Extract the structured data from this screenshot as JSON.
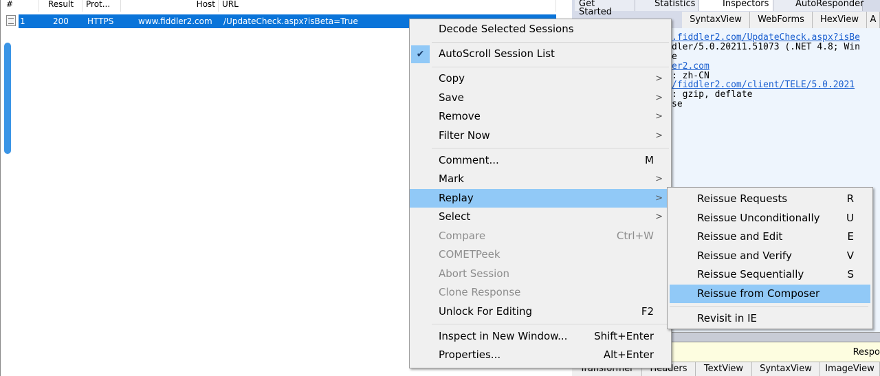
{
  "session_list": {
    "columns": [
      "#",
      "Result",
      "Prot...",
      "Host",
      "URL"
    ],
    "rows": [
      {
        "num": "1",
        "result": "200",
        "protocol": "HTTPS",
        "host": "www.fiddler2.com",
        "url": "/UpdateCheck.aspx?isBeta=True"
      }
    ]
  },
  "right_pane": {
    "tabs": [
      "Get Started",
      "Statistics",
      "Inspectors",
      "AutoResponder"
    ],
    "subtabs": [
      "SyntaxView",
      "WebForms",
      "HexView",
      "A"
    ],
    "request_lines": [
      ".fiddler2.com/UpdateCheck.aspx?isBe",
      "dler/5.0.20211.51073 (.NET 4.8; Win",
      "e",
      "er2.com",
      ": zh-CN",
      "/fiddler2.com/client/TELE/5.0.2021",
      ": gzip, deflate",
      "se"
    ],
    "response_bar": "Respo",
    "bottom_tabs": [
      "Transformer",
      "Headers",
      "TextView",
      "SyntaxView",
      "ImageView"
    ]
  },
  "context_menu": {
    "decode": "Decode Selected Sessions",
    "autoscroll": "AutoScroll Session List",
    "copy": "Copy",
    "save": "Save",
    "remove": "Remove",
    "filter_now": "Filter Now",
    "comment": "Comment...",
    "comment_sc": "M",
    "mark": "Mark",
    "replay": "Replay",
    "select": "Select",
    "compare": "Compare",
    "compare_sc": "Ctrl+W",
    "cometpeek": "COMETPeek",
    "abort": "Abort Session",
    "clone": "Clone Response",
    "unlock": "Unlock For Editing",
    "unlock_sc": "F2",
    "inspect": "Inspect in New Window...",
    "inspect_sc": "Shift+Enter",
    "properties": "Properties...",
    "properties_sc": "Alt+Enter"
  },
  "replay_submenu": {
    "items": [
      {
        "label": "Reissue Requests",
        "sc": "R"
      },
      {
        "label": "Reissue Unconditionally",
        "sc": "U"
      },
      {
        "label": "Reissue and Edit",
        "sc": "E"
      },
      {
        "label": "Reissue and Verify",
        "sc": "V"
      },
      {
        "label": "Reissue Sequentially",
        "sc": "S"
      },
      {
        "label": "Reissue from Composer",
        "sc": ""
      }
    ],
    "revisit": "Revisit in IE"
  },
  "colors": {
    "selection": "#0a74d9",
    "menu_highlight": "#91c9f7",
    "link": "#1a5fd0"
  }
}
